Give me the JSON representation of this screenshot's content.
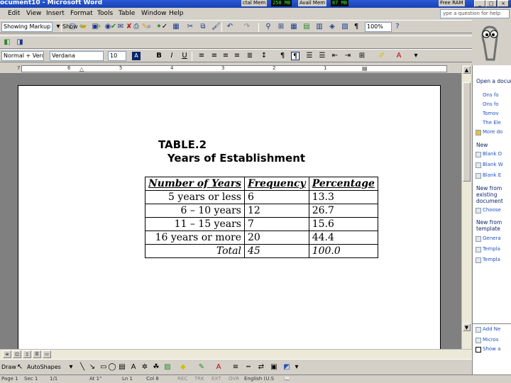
{
  "window": {
    "title": "ocument10 - Microsoft Word",
    "total_mem_label": "ctal Mem",
    "total_mem_value": "258 MB",
    "avail_mem_label": "Avail Mem",
    "avail_mem_value": "87 MB",
    "free_ram_label": "Free RAM"
  },
  "menu": {
    "items": [
      "Edit",
      "View",
      "Insert",
      "Format",
      "Tools",
      "Table",
      "Window",
      "Help"
    ],
    "help_placeholder": "ype a question for help"
  },
  "toolbar": {
    "markup_combo": "Showing Markup",
    "show_label": "Show",
    "zoom": "100%",
    "style_combo": "Normal + Verda",
    "font_combo": "Verdana",
    "size_combo": "10"
  },
  "ruler": {
    "ticks": [
      "7",
      "6",
      "5",
      "4",
      "3",
      "2",
      "1"
    ]
  },
  "document": {
    "table_title": "TABLE.2",
    "table_subtitle": "Years of Establishment",
    "headers": [
      "Number of Years",
      "Frequency",
      "Percentage"
    ],
    "rows": [
      [
        "5 years or less",
        "6",
        "13.3"
      ],
      [
        "6 – 10 years",
        "12",
        "26.7"
      ],
      [
        "11 – 15 years",
        "7",
        "15.6"
      ],
      [
        "16 years or more",
        "20",
        "44.4"
      ],
      [
        "Total",
        "45",
        "100.0"
      ]
    ]
  },
  "taskpane": {
    "open_header": "Open a document",
    "open_items": [
      "Ons fo",
      "Ons fo",
      "Tomov",
      "The Ele"
    ],
    "more_docs": "More do",
    "new_header": "New",
    "new_items": [
      "Blank D",
      "Blank W",
      "Blank E"
    ],
    "existing_header": "New from existing document",
    "choose_doc": "Choose",
    "template_header": "New from template",
    "template_items": [
      "Genera",
      "Templa",
      "Templa"
    ],
    "bottom_items": [
      "Add Ne",
      "Micros",
      "Show a"
    ]
  },
  "drawbar": {
    "draw_label": "Draw",
    "autoshapes_label": "AutoShapes"
  },
  "status": {
    "page": "Page 1",
    "sec": "Sec 1",
    "pages": "1/1",
    "at": "At 1\"",
    "ln": "Ln 1",
    "col": "Col 8",
    "rec": "REC",
    "trk": "TRK",
    "ext": "EXT",
    "ovr": "OVR",
    "lang": "English (U.S"
  }
}
